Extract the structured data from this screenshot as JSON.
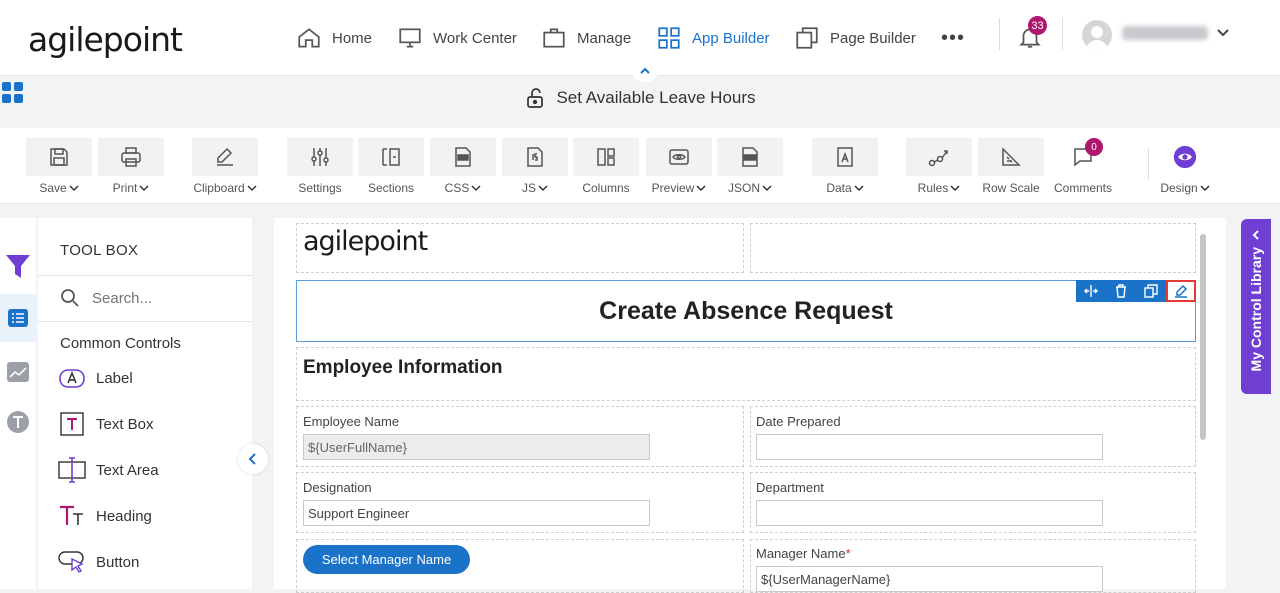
{
  "brand": {
    "logo": "agilepoint"
  },
  "nav": {
    "items": [
      {
        "label": "Home",
        "icon": "home-icon"
      },
      {
        "label": "Work Center",
        "icon": "monitor-icon"
      },
      {
        "label": "Manage",
        "icon": "briefcase-icon"
      },
      {
        "label": "App Builder",
        "icon": "grid-icon",
        "active": true
      },
      {
        "label": "Page Builder",
        "icon": "pages-icon"
      }
    ],
    "more": "•••",
    "notifications": "33"
  },
  "page": {
    "title": "Set Available Leave Hours"
  },
  "toolbar": {
    "save": "Save",
    "print": "Print",
    "clipboard": "Clipboard",
    "settings": "Settings",
    "sections": "Sections",
    "css": "CSS",
    "js": "JS",
    "columns": "Columns",
    "preview": "Preview",
    "json": "JSON",
    "data": "Data",
    "rules": "Rules",
    "row_scale": "Row Scale",
    "comments": "Comments",
    "comments_count": "0",
    "design": "Design"
  },
  "toolbox": {
    "title": "TOOL BOX",
    "search_placeholder": "Search...",
    "section": "Common Controls",
    "controls": [
      "Label",
      "Text Box",
      "Text Area",
      "Heading",
      "Button"
    ]
  },
  "form": {
    "logo": "agilepoint",
    "title": "Create Absence Request",
    "section": "Employee Information",
    "fields": {
      "employee_name": {
        "label": "Employee Name",
        "value": "${UserFullName}"
      },
      "date_prepared": {
        "label": "Date Prepared",
        "value": ""
      },
      "designation": {
        "label": "Designation",
        "value": "Support Engineer"
      },
      "department": {
        "label": "Department",
        "value": ""
      },
      "manager_name": {
        "label": "Manager Name",
        "required": "*",
        "value": "${UserManagerName}"
      }
    },
    "manager_button": "Select Manager Name"
  },
  "right_panel": {
    "label": "My Control Library"
  },
  "colors": {
    "accent": "#1a73c8",
    "badge": "#b0166f",
    "library": "#6f3fd4",
    "highlight": "#e53935"
  }
}
